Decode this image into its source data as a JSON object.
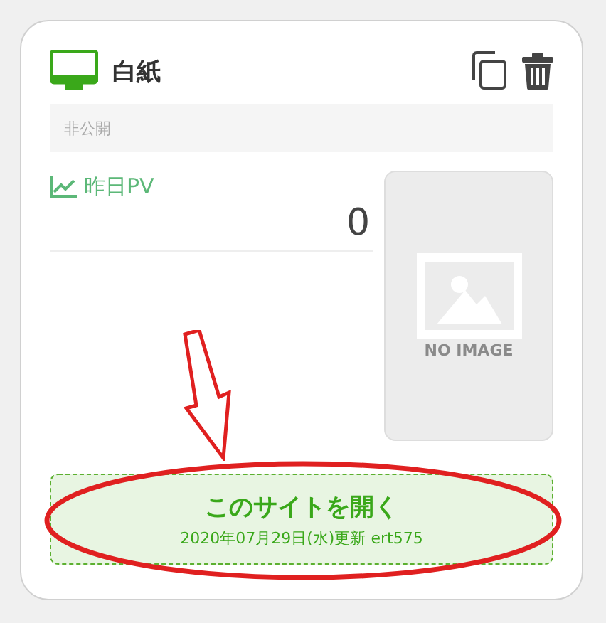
{
  "card": {
    "title": "白紙",
    "visibility": "非公開",
    "stat": {
      "label": "昨日PV",
      "value": "0"
    },
    "thumbnail": {
      "text": "NO IMAGE"
    },
    "open_button": {
      "label": "このサイトを開く",
      "updated": "2020年07月29日(水)更新 ert575"
    }
  }
}
